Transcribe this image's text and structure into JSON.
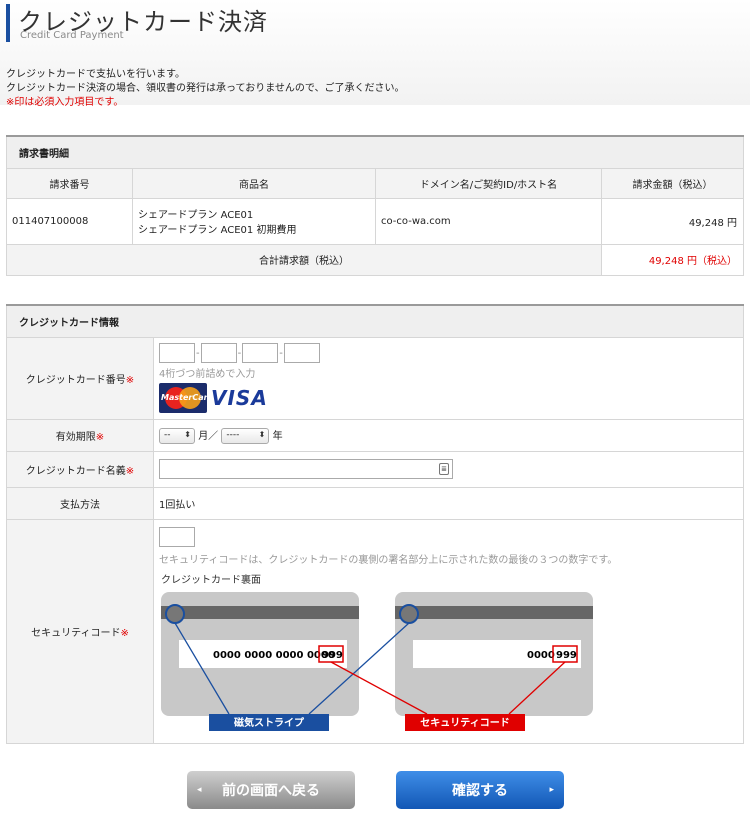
{
  "header": {
    "title": "クレジットカード決済",
    "subtitle": "Credit Card Payment",
    "intro_line1": "クレジットカードで支払いを行います。",
    "intro_line2": "クレジットカード決済の場合、領収書の発行は承っておりませんので、ご了承ください。",
    "required_note": "※印は必須入力項目です。"
  },
  "invoice": {
    "section_title": "請求書明細",
    "columns": [
      "請求番号",
      "商品名",
      "ドメイン名/ご契約ID/ホスト名",
      "請求金額（税込）"
    ],
    "rows": [
      {
        "invoice_no": "011407100008",
        "product_line1": "シェアードプラン ACE01",
        "product_line2": "シェアードプラン ACE01 初期費用",
        "domain": "co-co-wa.com",
        "amount": "49,248 円"
      }
    ],
    "total_label": "合計請求額（税込）",
    "total_value": "49,248 円（税込）"
  },
  "card": {
    "section_title": "クレジットカード情報",
    "number_label": "クレジットカード番号",
    "required_mark": "※",
    "number_hint": "4桁づつ前詰めで入力",
    "number_values": [
      "",
      "",
      "",
      ""
    ],
    "mastercard_text": "MasterCard",
    "visa_text": "VISA",
    "expiry_label": "有効期限",
    "expiry_month": "--",
    "month_unit": "月／",
    "expiry_year": "----",
    "year_unit": "年",
    "name_label": "クレジットカード名義",
    "name_value": "",
    "name_icon": "≣",
    "payment_label": "支払方法",
    "payment_value": "1回払い",
    "security_label": "セキュリティコード",
    "security_value": "",
    "security_hint": "セキュリティコードは、クレジットカードの裏側の署名部分上に示された数の最後の３つの数字です。",
    "card_back_label": "クレジットカード裏面",
    "diagram": {
      "left_number": "0000 0000 0000 0000",
      "right_number": "0000",
      "code": "999",
      "stripe_label": "磁気ストライプ",
      "code_label": "セキュリティコード"
    }
  },
  "buttons": {
    "back_label": "前の画面へ戻る",
    "confirm_label": "確認する",
    "back_chevron": "◂",
    "confirm_chevron": "▸"
  },
  "colors": {
    "accent": "#1a4fa0",
    "required": "#e00000",
    "stripe_line": "#1a4fa0",
    "code_line": "#e00000"
  }
}
